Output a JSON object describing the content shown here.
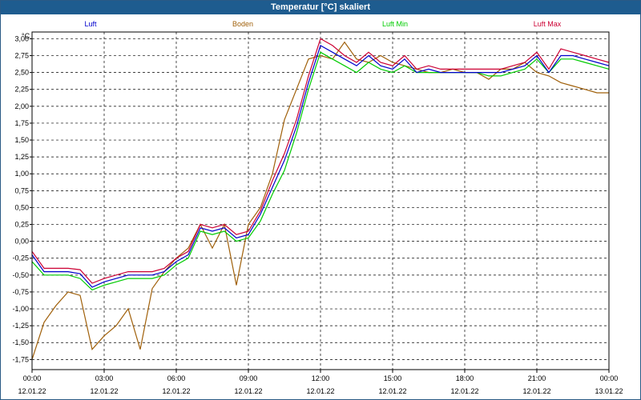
{
  "window": {
    "title": "Temperatur [°C] skaliert"
  },
  "colors": {
    "titlebar": "#1e5c8f",
    "luft": "#0000cc",
    "boden": "#a0600a",
    "luft_min": "#00cc00",
    "luft_max": "#cc0033",
    "grid": "#000000"
  },
  "chart_data": {
    "type": "line",
    "title": "Temperatur [°C] skaliert",
    "ylabel": "°C",
    "xlabel": "",
    "ylim": [
      -1.9,
      3.1
    ],
    "xlim": [
      0,
      24
    ],
    "grid": true,
    "legend_placement": "top",
    "y_ticks": [
      "3,00",
      "2,75",
      "2,50",
      "2,25",
      "2,00",
      "1,75",
      "1,50",
      "1,25",
      "1,00",
      "0,75",
      "0,50",
      "0,25",
      "0,00",
      "-0,25",
      "-0,50",
      "-0,75",
      "-1,00",
      "-1,25",
      "-1,50",
      "-1,75"
    ],
    "y_tick_values": [
      3.0,
      2.75,
      2.5,
      2.25,
      2.0,
      1.75,
      1.5,
      1.25,
      1.0,
      0.75,
      0.5,
      0.25,
      0.0,
      -0.25,
      -0.5,
      -0.75,
      -1.0,
      -1.25,
      -1.5,
      -1.75
    ],
    "x_ticks": [
      {
        "x": 0,
        "time": "00:00",
        "date": "12.01.22"
      },
      {
        "x": 3,
        "time": "03:00",
        "date": "12.01.22"
      },
      {
        "x": 6,
        "time": "06:00",
        "date": "12.01.22"
      },
      {
        "x": 9,
        "time": "09:00",
        "date": "12.01.22"
      },
      {
        "x": 12,
        "time": "12:00",
        "date": "12.01.22"
      },
      {
        "x": 15,
        "time": "15:00",
        "date": "12.01.22"
      },
      {
        "x": 18,
        "time": "18:00",
        "date": "12.01.22"
      },
      {
        "x": 21,
        "time": "21:00",
        "date": "12.01.22"
      },
      {
        "x": 24,
        "time": "00:00",
        "date": "13.01.22"
      }
    ],
    "x": [
      0,
      0.5,
      1,
      1.5,
      2,
      2.5,
      3,
      3.5,
      4,
      4.5,
      5,
      5.5,
      6,
      6.5,
      7,
      7.5,
      8,
      8.5,
      9,
      9.5,
      10,
      10.5,
      11,
      11.5,
      12,
      12.5,
      13,
      13.5,
      14,
      14.5,
      15,
      15.5,
      16,
      16.5,
      17,
      17.5,
      18,
      18.5,
      19,
      19.5,
      20,
      20.5,
      21,
      21.5,
      22,
      22.5,
      23,
      23.5,
      24
    ],
    "series": [
      {
        "name": "Luft",
        "color": "#0000cc",
        "values": [
          -0.2,
          -0.45,
          -0.45,
          -0.45,
          -0.48,
          -0.68,
          -0.6,
          -0.55,
          -0.5,
          -0.5,
          -0.5,
          -0.45,
          -0.3,
          -0.2,
          0.2,
          0.15,
          0.2,
          0.05,
          0.1,
          0.4,
          0.8,
          1.2,
          1.7,
          2.35,
          2.9,
          2.8,
          2.7,
          2.6,
          2.75,
          2.6,
          2.55,
          2.7,
          2.5,
          2.55,
          2.5,
          2.5,
          2.5,
          2.5,
          2.5,
          2.5,
          2.55,
          2.6,
          2.75,
          2.5,
          2.75,
          2.75,
          2.7,
          2.65,
          2.6
        ]
      },
      {
        "name": "Boden",
        "color": "#a0600a",
        "values": [
          -1.75,
          -1.2,
          -0.95,
          -0.75,
          -0.8,
          -1.6,
          -1.4,
          -1.25,
          -1.0,
          -1.6,
          -0.7,
          -0.45,
          -0.25,
          -0.1,
          0.25,
          -0.1,
          0.25,
          -0.65,
          0.25,
          0.5,
          1.0,
          1.8,
          2.25,
          2.7,
          2.75,
          2.7,
          2.95,
          2.7,
          2.65,
          2.75,
          2.65,
          2.6,
          2.55,
          2.5,
          2.5,
          2.55,
          2.5,
          2.5,
          2.4,
          2.55,
          2.55,
          2.65,
          2.5,
          2.45,
          2.35,
          2.3,
          2.25,
          2.2,
          2.2
        ]
      },
      {
        "name": "Luft Min",
        "color": "#00cc00",
        "values": [
          -0.3,
          -0.5,
          -0.5,
          -0.5,
          -0.55,
          -0.72,
          -0.65,
          -0.6,
          -0.55,
          -0.55,
          -0.55,
          -0.5,
          -0.35,
          -0.25,
          0.15,
          0.1,
          0.15,
          -0.0,
          0.05,
          0.3,
          0.7,
          1.05,
          1.6,
          2.25,
          2.8,
          2.7,
          2.6,
          2.5,
          2.65,
          2.55,
          2.5,
          2.6,
          2.5,
          2.5,
          2.5,
          2.5,
          2.5,
          2.5,
          2.45,
          2.45,
          2.5,
          2.55,
          2.7,
          2.5,
          2.7,
          2.7,
          2.65,
          2.6,
          2.55
        ]
      },
      {
        "name": "Luft Max",
        "color": "#cc0033",
        "values": [
          -0.15,
          -0.4,
          -0.4,
          -0.4,
          -0.42,
          -0.62,
          -0.55,
          -0.5,
          -0.45,
          -0.45,
          -0.45,
          -0.4,
          -0.25,
          -0.15,
          0.25,
          0.2,
          0.25,
          0.1,
          0.15,
          0.45,
          0.9,
          1.3,
          1.8,
          2.45,
          3.0,
          2.9,
          2.75,
          2.65,
          2.8,
          2.65,
          2.6,
          2.75,
          2.55,
          2.6,
          2.55,
          2.55,
          2.55,
          2.55,
          2.55,
          2.55,
          2.6,
          2.65,
          2.8,
          2.55,
          2.85,
          2.8,
          2.75,
          2.7,
          2.65
        ]
      }
    ]
  }
}
